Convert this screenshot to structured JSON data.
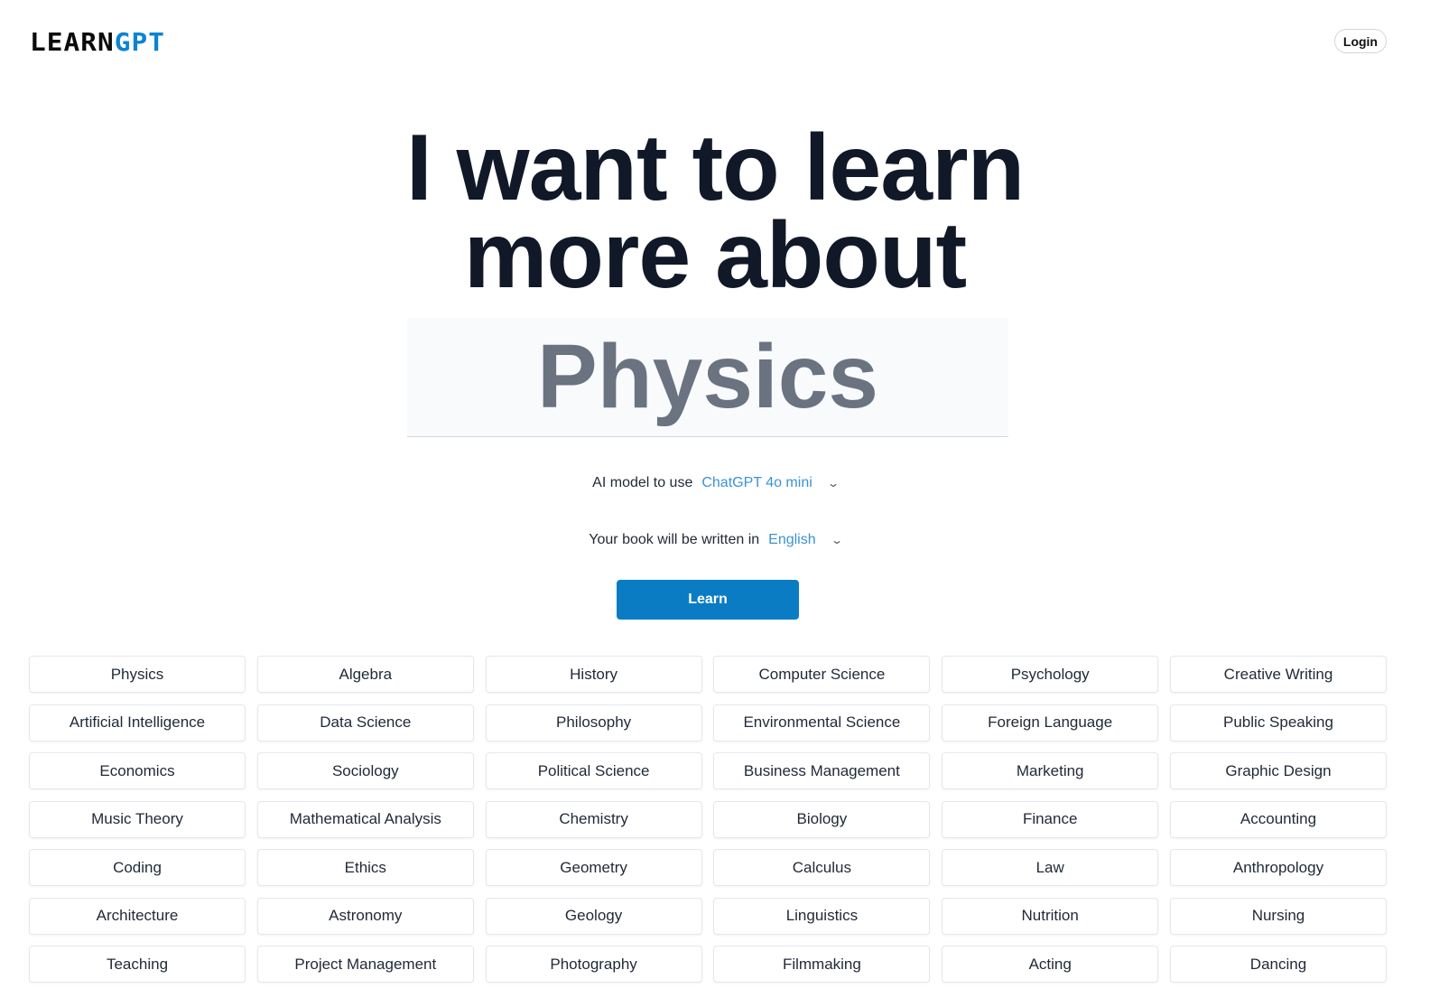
{
  "header": {
    "logo_part1": "LEARN",
    "logo_part2": "GPT",
    "login_label": "Login"
  },
  "hero": {
    "line1": "I want to learn",
    "line2": "more about",
    "topic_value": "Physics"
  },
  "model": {
    "label": "AI model to use",
    "value": "ChatGPT 4o mini"
  },
  "language": {
    "label": "Your book will be written in",
    "value": "English"
  },
  "learn_label": "Learn",
  "colors": {
    "accent": "#0a7cc4",
    "link": "#3b93d1",
    "logo_blue": "#0a84d0"
  },
  "topics": [
    "Physics",
    "Algebra",
    "History",
    "Computer Science",
    "Psychology",
    "Creative Writing",
    "Artificial Intelligence",
    "Data Science",
    "Philosophy",
    "Environmental Science",
    "Foreign Language",
    "Public Speaking",
    "Economics",
    "Sociology",
    "Political Science",
    "Business Management",
    "Marketing",
    "Graphic Design",
    "Music Theory",
    "Mathematical Analysis",
    "Chemistry",
    "Biology",
    "Finance",
    "Accounting",
    "Coding",
    "Ethics",
    "Geometry",
    "Calculus",
    "Law",
    "Anthropology",
    "Architecture",
    "Astronomy",
    "Geology",
    "Linguistics",
    "Nutrition",
    "Nursing",
    "Teaching",
    "Project Management",
    "Photography",
    "Filmmaking",
    "Acting",
    "Dancing"
  ]
}
